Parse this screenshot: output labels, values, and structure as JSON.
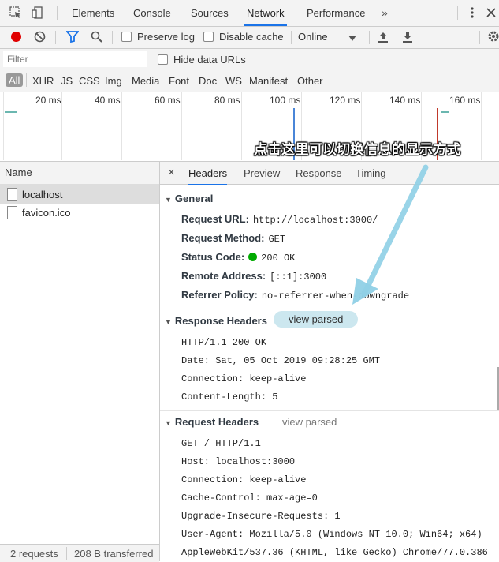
{
  "tabs": [
    "Elements",
    "Console",
    "Sources",
    "Network",
    "Performance"
  ],
  "tabs_more": "»",
  "active_tab": "Network",
  "toolbar": {
    "preserve_log": "Preserve log",
    "disable_cache": "Disable cache",
    "throttle": "Online"
  },
  "filter": {
    "placeholder": "Filter",
    "hide_data_urls": "Hide data URLs",
    "types": [
      "All",
      "XHR",
      "JS",
      "CSS",
      "Img",
      "Media",
      "Font",
      "Doc",
      "WS",
      "Manifest",
      "Other"
    ]
  },
  "timeline": {
    "ticks": [
      "20 ms",
      "40 ms",
      "60 ms",
      "80 ms",
      "100 ms",
      "120 ms",
      "140 ms",
      "160 ms"
    ]
  },
  "annotation": "点击这里可以切换信息的显示方式",
  "requests": {
    "header": "Name",
    "items": [
      "localhost",
      "favicon.ico"
    ],
    "status": "2 requests",
    "transferred": "208 B transferred"
  },
  "details": {
    "close": "×",
    "tabs": [
      "Headers",
      "Preview",
      "Response",
      "Timing"
    ],
    "general": {
      "title": "General",
      "rows": [
        {
          "key": "Request URL:",
          "value": "http://localhost:3000/"
        },
        {
          "key": "Request Method:",
          "value": "GET"
        },
        {
          "key": "Status Code:",
          "value": "200 OK"
        },
        {
          "key": "Remote Address:",
          "value": "[::1]:3000"
        },
        {
          "key": "Referrer Policy:",
          "value": "no-referrer-when-downgrade"
        }
      ]
    },
    "response_headers": {
      "title": "Response Headers",
      "view_parsed": "view parsed",
      "lines": [
        "HTTP/1.1 200 OK",
        "Date: Sat, 05 Oct 2019 09:28:25 GMT",
        "Connection: keep-alive",
        "Content-Length: 5"
      ]
    },
    "request_headers": {
      "title": "Request Headers",
      "view_parsed": "view parsed",
      "lines": [
        "GET / HTTP/1.1",
        "Host: localhost:3000",
        "Connection: keep-alive",
        "Cache-Control: max-age=0",
        "Upgrade-Insecure-Requests: 1",
        "User-Agent: Mozilla/5.0 (Windows NT 10.0; Win64; x64)",
        "AppleWebKit/537.36 (KHTML, like Gecko) Chrome/77.0.386"
      ]
    }
  },
  "colors": {
    "record": "#e00000",
    "accent": "#1a73e8",
    "status_ok": "#00aa00",
    "highlight": "#cce7ef",
    "arrow": "#8fd0e6"
  }
}
